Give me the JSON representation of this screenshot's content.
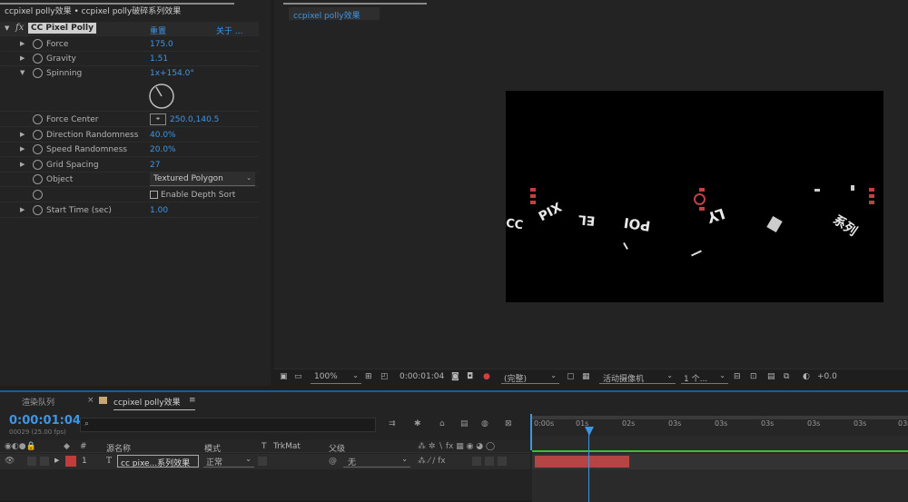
{
  "effect_panel": {
    "tab": "ccpixel polly效果 • ccpixel polly破碎系列效果",
    "effect_name": "CC Pixel Polly",
    "reset": "重置",
    "about": "关于 ...",
    "fx_symbol": "fx",
    "props": {
      "force": {
        "label": "Force",
        "value": "175.0"
      },
      "gravity": {
        "label": "Gravity",
        "value": "1.51"
      },
      "spinning": {
        "label": "Spinning",
        "value": "1x+154.0°"
      },
      "force_center": {
        "label": "Force Center",
        "value": "250.0,140.5"
      },
      "direction_randomness": {
        "label": "Direction Randomness",
        "value": "40.0%"
      },
      "speed_randomness": {
        "label": "Speed Randomness",
        "value": "20.0%"
      },
      "grid_spacing": {
        "label": "Grid Spacing",
        "value": "27"
      },
      "object": {
        "label": "Object",
        "value": "Textured Polygon"
      },
      "depth_sort": {
        "label": "Enable Depth Sort"
      },
      "start_time": {
        "label": "Start Time (sec)",
        "value": "1.00"
      }
    }
  },
  "composition": {
    "tab": "ccpixel polly效果",
    "fragments": [
      "CC",
      "PIX",
      "EL",
      "POI",
      "LY",
      "系列"
    ],
    "bar": {
      "zoom": "100%",
      "timecode": "0:00:01:04",
      "resolution": "(完整)",
      "camera": "活动摄像机",
      "views": "1 个...",
      "exposure": "+0.0"
    }
  },
  "timeline": {
    "render_queue_tab": "渲染队列",
    "comp_tab": "ccpixel polly效果",
    "timecode": "0:00:01:04",
    "frames_fps": "00029 (25.00 fps)",
    "search_placeholder": "",
    "columns": {
      "number": "#",
      "source_name": "源名称",
      "mode": "模式",
      "t": "T",
      "trkmat": "TrkMat",
      "parent": "父级"
    },
    "layer": {
      "index": "1",
      "type_icon": "T",
      "name": "cc pixe...系列效果",
      "mode": "正常",
      "parent": "无"
    },
    "ruler_ticks": [
      "0:00s",
      "01s",
      "02s",
      "03s",
      "03s",
      "03s",
      "03s",
      "03s",
      "03s",
      "08"
    ]
  },
  "colors": {
    "accent_blue": "#3d95e6",
    "layer_label_red": "#c23c3c",
    "track_bar_red": "#b54545",
    "green_line": "#3bbf3b",
    "canvas_bg": "#000000"
  }
}
